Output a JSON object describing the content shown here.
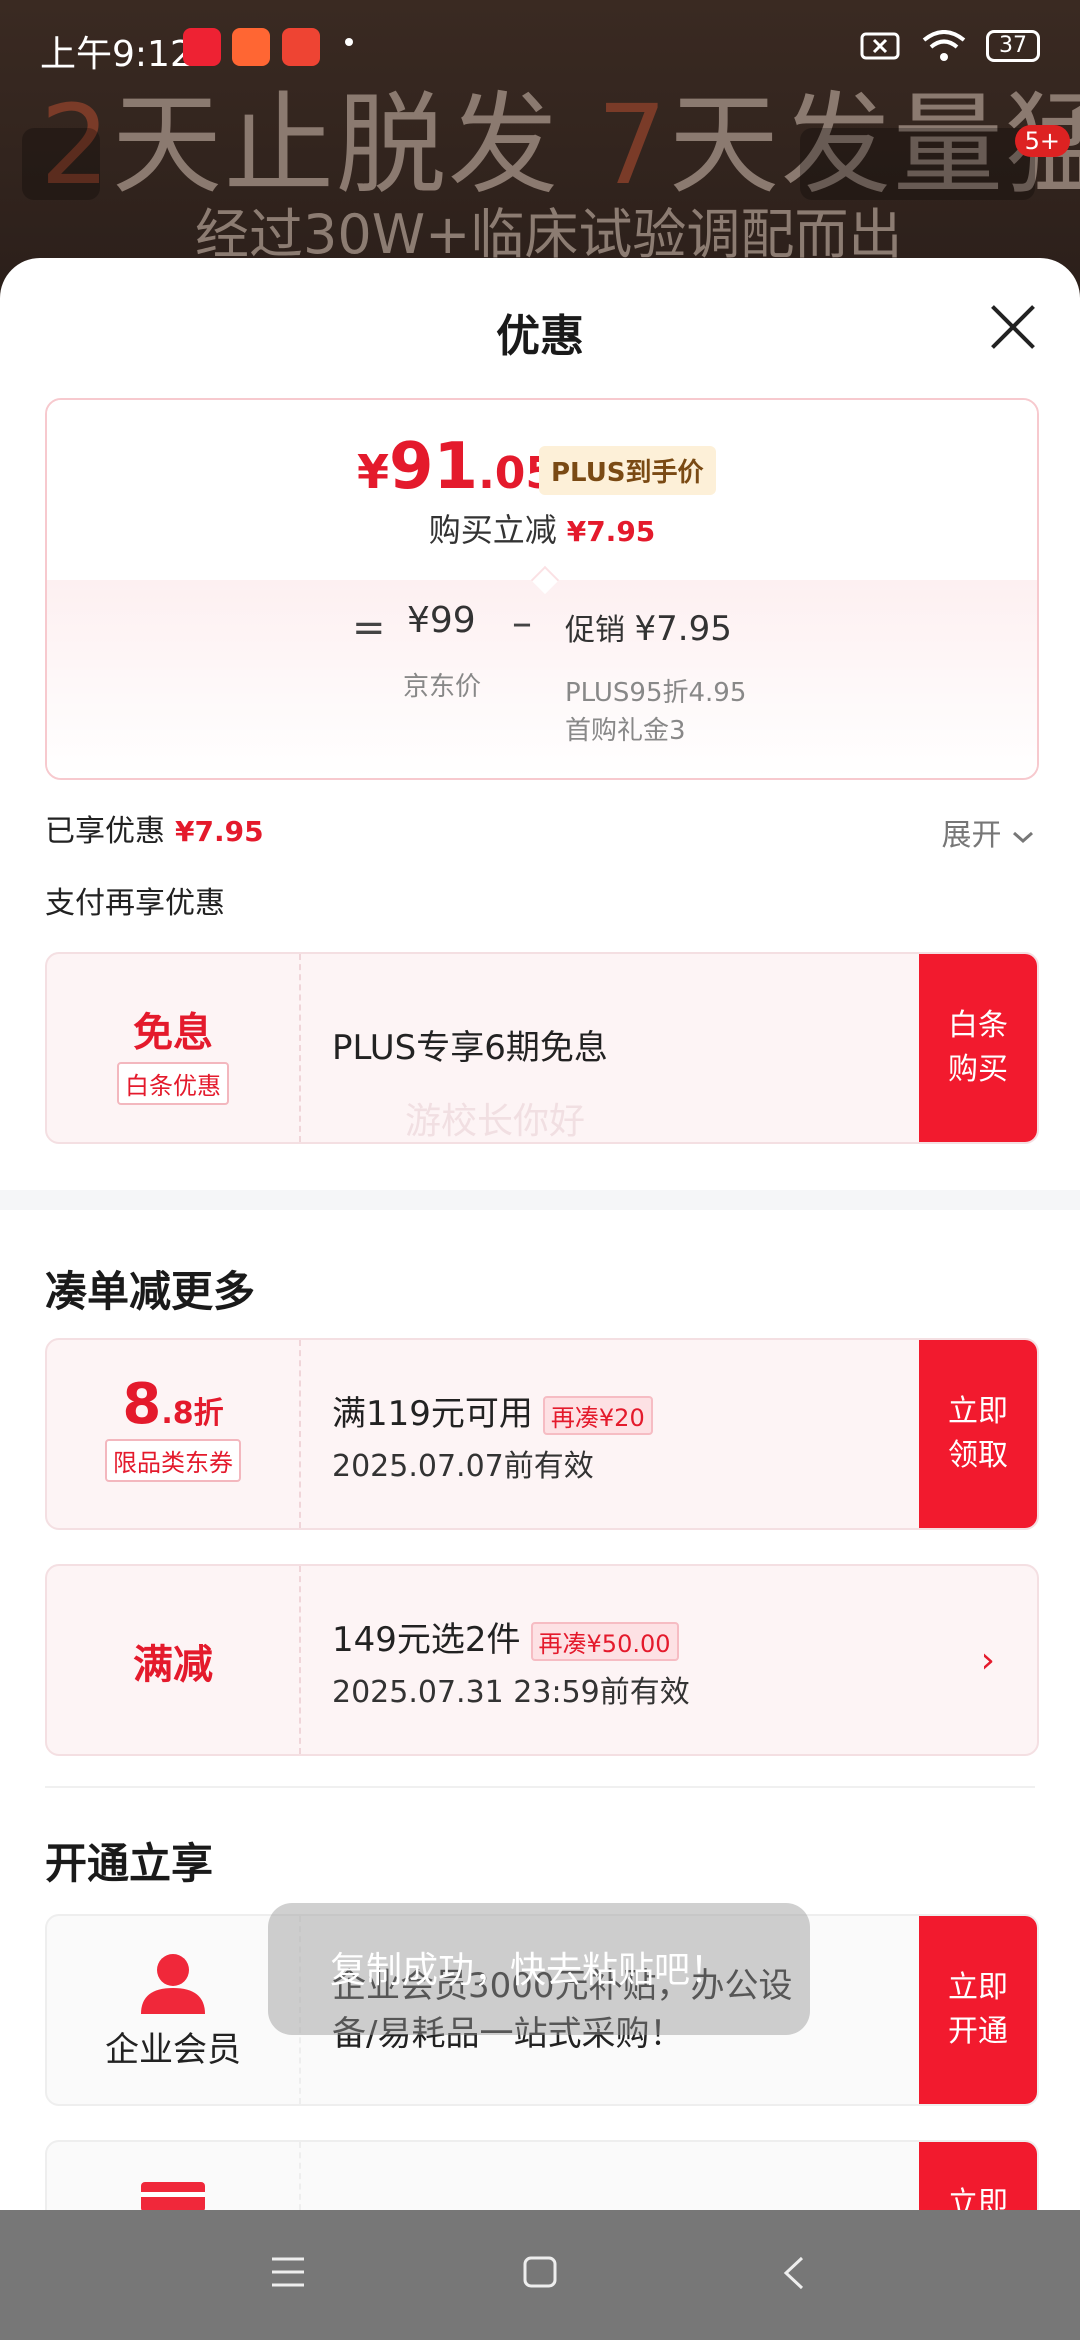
{
  "status": {
    "time": "上午9:12",
    "battery": "37",
    "notification_badge": "5+"
  },
  "background": {
    "headline_num1": "2",
    "headline_text1": "天止脱发",
    "headline_num2": "7",
    "headline_text2": "天发量猛涨",
    "subline": "经过30W+临床试验调配而出"
  },
  "sheet": {
    "title": "优惠",
    "price": {
      "yen": "¥",
      "int": "91",
      "dec": ".05",
      "plus_tag": "PLUS到手价",
      "reduce_label": "购买立减",
      "reduce_value": "¥7.95",
      "eq": "=",
      "jd_price": "¥99",
      "jd_label": "京东价",
      "minus": "–",
      "promo_label": "促销",
      "promo_value": "¥7.95",
      "promo_sub1": "PLUS95折4.95",
      "promo_sub2": "首购礼金3"
    },
    "enjoyed_label": "已享优惠",
    "enjoyed_value": "¥7.95",
    "expand_label": "展开",
    "pay_title": "支付再享优惠",
    "baitiao": {
      "big": "免息",
      "tag": "白条优惠",
      "text": "PLUS专享6期免息",
      "action_line1": "白条",
      "action_line2": "购买"
    },
    "watermark": "游校长你好",
    "section_more": "凑单减更多",
    "coupon1": {
      "big": "8",
      "small": ".8折",
      "tag": "限品类东券",
      "line1": "满119元可用",
      "pill": "再凑¥20",
      "line2": "2025.07.07前有效",
      "action_line1": "立即",
      "action_line2": "领取"
    },
    "coupon2": {
      "big": "满减",
      "line1": "149元选2件",
      "pill": "再凑¥50.00",
      "line2": "2025.07.31 23:59前有效",
      "arrow": "›"
    },
    "section_open": "开通立享",
    "enterprise": {
      "label": "企业会员",
      "line1": "企业会员3000元补贴，办公设",
      "line2": "备/易耗品一站式采购！",
      "action_line1": "立即",
      "action_line2": "开通"
    },
    "partial_action": "立即"
  },
  "toast": "复制成功，快去粘贴吧！",
  "colors": {
    "accent_red": "#e41a2c",
    "button_red": "#f21a2e",
    "plus_gold": "#7a4a14"
  }
}
